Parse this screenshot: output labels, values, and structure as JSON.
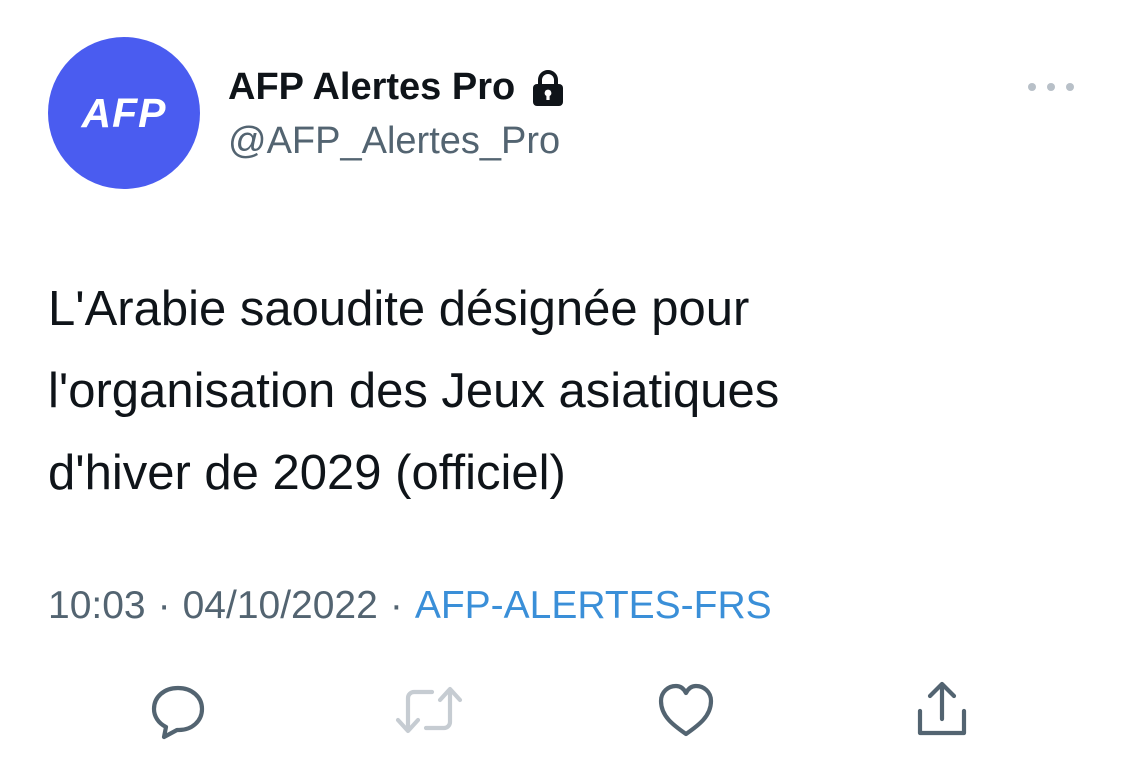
{
  "account": {
    "avatar_text": "AFP",
    "display_name": "AFP Alertes Pro",
    "handle": "@AFP_Alertes_Pro",
    "protected_icon": "lock-icon",
    "avatar_color": "#4a5cf0"
  },
  "tweet": {
    "lines": [
      "L'Arabie saoudite désignée pour",
      "l'organisation des Jeux asiatiques",
      "d'hiver de 2029 (officiel)"
    ]
  },
  "meta": {
    "time": "10:03",
    "date": "04/10/2022",
    "separator": "·",
    "source": "AFP-ALERTES-FRS",
    "source_color": "#3a8fd8"
  },
  "actions": {
    "reply_icon": "reply-icon",
    "retweet_icon": "retweet-icon",
    "like_icon": "heart-icon",
    "share_icon": "share-icon",
    "more_icon": "more-icon"
  }
}
